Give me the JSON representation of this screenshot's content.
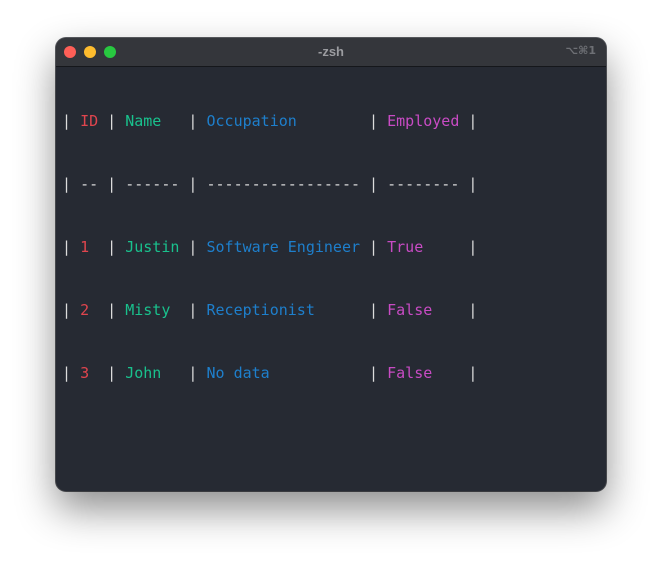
{
  "window": {
    "title": "-zsh",
    "shortcut": "⌥⌘1"
  },
  "colors": {
    "id": "#e0454e",
    "name": "#19c18d",
    "occupation": "#1e7fcc",
    "employed": "#c84bc4",
    "background": "#262a33"
  },
  "table": {
    "headers": {
      "id": "ID",
      "name": "Name",
      "occupation": "Occupation",
      "employed": "Employed"
    },
    "separators": {
      "id": "--",
      "name": "------",
      "occupation": "-----------------",
      "employed": "--------"
    },
    "rows": [
      {
        "id": "1",
        "name": "Justin",
        "occupation": "Software Engineer",
        "employed": "True"
      },
      {
        "id": "2",
        "name": "Misty",
        "occupation": "Receptionist",
        "employed": "False"
      },
      {
        "id": "3",
        "name": "John",
        "occupation": "No data",
        "employed": "False"
      }
    ]
  }
}
